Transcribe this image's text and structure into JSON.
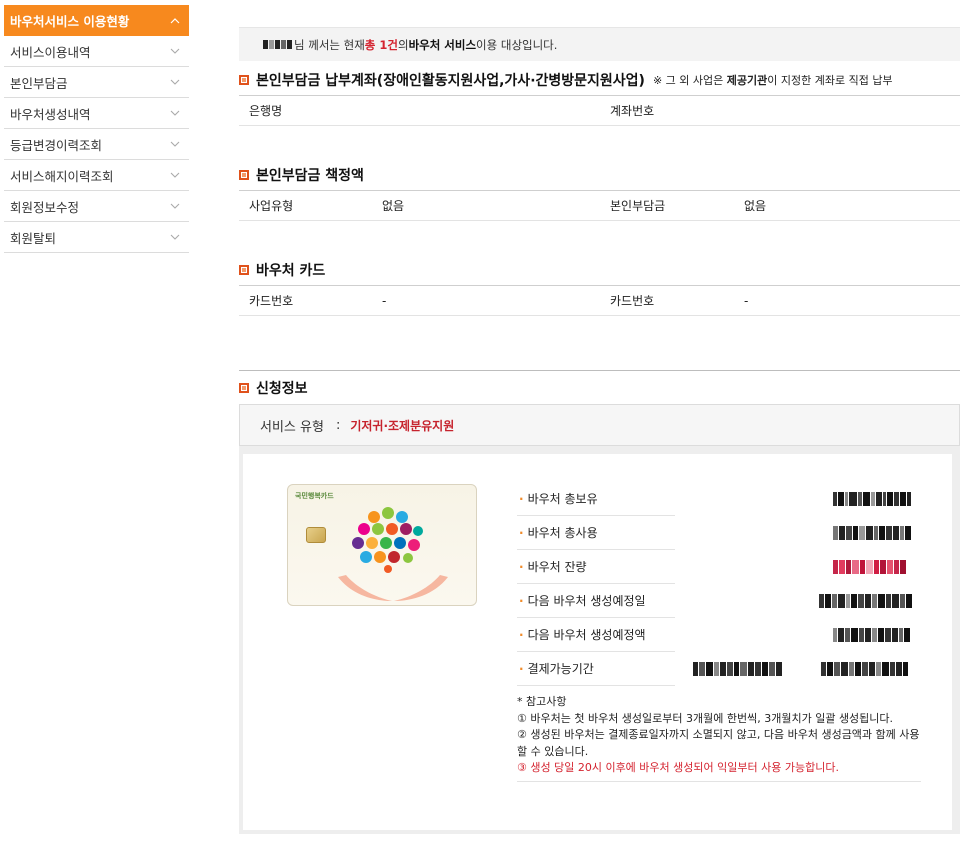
{
  "sidebar": {
    "items": [
      {
        "label": "바우처서비스 이용현황",
        "active": true
      },
      {
        "label": "서비스이용내역",
        "active": false
      },
      {
        "label": "본인부담금",
        "active": false
      },
      {
        "label": "바우처생성내역",
        "active": false
      },
      {
        "label": "등급변경이력조회",
        "active": false
      },
      {
        "label": "서비스해지이력조회",
        "active": false
      },
      {
        "label": "회원정보수정",
        "active": false
      },
      {
        "label": "회원탈퇴",
        "active": false
      }
    ]
  },
  "notice": {
    "suffix_1": "님 께서는 현재 ",
    "count": "총 1건",
    "suffix_2": " 의 ",
    "service": "바우처 서비스",
    "suffix_3": " 이용 대상입니다."
  },
  "account_section": {
    "title": "본인부담금 납부계좌(장애인활동지원사업,가사·간병방문지원사업)",
    "note_prefix": "※ 그 외 사업은 ",
    "note_bold": "제공기관",
    "note_suffix": "이 지정한 계좌로 직접 납부",
    "bank_label": "은행명",
    "account_label": "계좌번호"
  },
  "copay_section": {
    "title": "본인부담금 책정액",
    "biz_type_label": "사업유형",
    "biz_type_value": "없음",
    "copay_label": "본인부담금",
    "copay_value": "없음"
  },
  "card_section": {
    "title": "바우처 카드",
    "card_no_label_1": "카드번호",
    "card_no_value_1": "-",
    "card_no_label_2": "카드번호",
    "card_no_value_2": "-"
  },
  "application_section": {
    "title": "신청정보",
    "service_type_label": "서비스 유형",
    "service_type_colon": ":",
    "service_type_value": "기저귀·조제분유지원",
    "card_logo_text": "국민행복카드",
    "voucher_rows": [
      {
        "label": "바우처 총보유"
      },
      {
        "label": "바우처 총사용"
      },
      {
        "label": "바우처 잔량"
      },
      {
        "label": "다음 바우처 생성예정일"
      },
      {
        "label": "다음 바우처 생성예정액"
      },
      {
        "label": "결제가능기간"
      }
    ],
    "reference": {
      "heading": "* 참고사항",
      "line1": "① 바우처는 첫 바우처 생성일로부터 3개월에 한번씩, 3개월치가 일괄 생성됩니다.",
      "line2": "② 생성된 바우처는 결제종료일자까지 소멸되지 않고, 다음 바우처 생성금액과 함께 사용할 수 있습니다.",
      "line3": "③ 생성 당일 20시 이후에 바우처 생성되어 익일부터 사용 가능합니다."
    }
  },
  "colors": {
    "accent": "#f7891e",
    "highlight_red": "#d4232f",
    "section_icon": "#e0521c"
  }
}
